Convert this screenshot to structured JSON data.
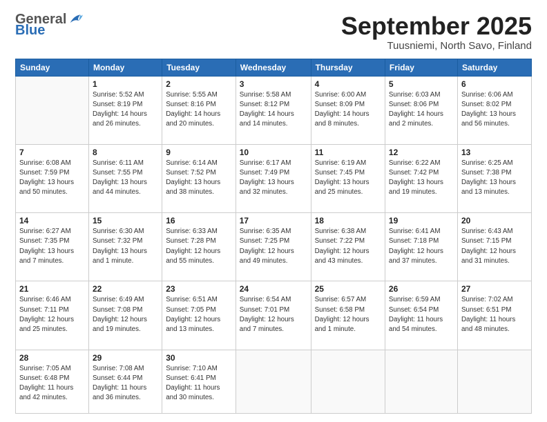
{
  "logo": {
    "general": "General",
    "blue": "Blue"
  },
  "title": "September 2025",
  "subtitle": "Tuusniemi, North Savo, Finland",
  "headers": [
    "Sunday",
    "Monday",
    "Tuesday",
    "Wednesday",
    "Thursday",
    "Friday",
    "Saturday"
  ],
  "weeks": [
    [
      {
        "day": "",
        "info": ""
      },
      {
        "day": "1",
        "info": "Sunrise: 5:52 AM\nSunset: 8:19 PM\nDaylight: 14 hours\nand 26 minutes."
      },
      {
        "day": "2",
        "info": "Sunrise: 5:55 AM\nSunset: 8:16 PM\nDaylight: 14 hours\nand 20 minutes."
      },
      {
        "day": "3",
        "info": "Sunrise: 5:58 AM\nSunset: 8:12 PM\nDaylight: 14 hours\nand 14 minutes."
      },
      {
        "day": "4",
        "info": "Sunrise: 6:00 AM\nSunset: 8:09 PM\nDaylight: 14 hours\nand 8 minutes."
      },
      {
        "day": "5",
        "info": "Sunrise: 6:03 AM\nSunset: 8:06 PM\nDaylight: 14 hours\nand 2 minutes."
      },
      {
        "day": "6",
        "info": "Sunrise: 6:06 AM\nSunset: 8:02 PM\nDaylight: 13 hours\nand 56 minutes."
      }
    ],
    [
      {
        "day": "7",
        "info": "Sunrise: 6:08 AM\nSunset: 7:59 PM\nDaylight: 13 hours\nand 50 minutes."
      },
      {
        "day": "8",
        "info": "Sunrise: 6:11 AM\nSunset: 7:55 PM\nDaylight: 13 hours\nand 44 minutes."
      },
      {
        "day": "9",
        "info": "Sunrise: 6:14 AM\nSunset: 7:52 PM\nDaylight: 13 hours\nand 38 minutes."
      },
      {
        "day": "10",
        "info": "Sunrise: 6:17 AM\nSunset: 7:49 PM\nDaylight: 13 hours\nand 32 minutes."
      },
      {
        "day": "11",
        "info": "Sunrise: 6:19 AM\nSunset: 7:45 PM\nDaylight: 13 hours\nand 25 minutes."
      },
      {
        "day": "12",
        "info": "Sunrise: 6:22 AM\nSunset: 7:42 PM\nDaylight: 13 hours\nand 19 minutes."
      },
      {
        "day": "13",
        "info": "Sunrise: 6:25 AM\nSunset: 7:38 PM\nDaylight: 13 hours\nand 13 minutes."
      }
    ],
    [
      {
        "day": "14",
        "info": "Sunrise: 6:27 AM\nSunset: 7:35 PM\nDaylight: 13 hours\nand 7 minutes."
      },
      {
        "day": "15",
        "info": "Sunrise: 6:30 AM\nSunset: 7:32 PM\nDaylight: 13 hours\nand 1 minute."
      },
      {
        "day": "16",
        "info": "Sunrise: 6:33 AM\nSunset: 7:28 PM\nDaylight: 12 hours\nand 55 minutes."
      },
      {
        "day": "17",
        "info": "Sunrise: 6:35 AM\nSunset: 7:25 PM\nDaylight: 12 hours\nand 49 minutes."
      },
      {
        "day": "18",
        "info": "Sunrise: 6:38 AM\nSunset: 7:22 PM\nDaylight: 12 hours\nand 43 minutes."
      },
      {
        "day": "19",
        "info": "Sunrise: 6:41 AM\nSunset: 7:18 PM\nDaylight: 12 hours\nand 37 minutes."
      },
      {
        "day": "20",
        "info": "Sunrise: 6:43 AM\nSunset: 7:15 PM\nDaylight: 12 hours\nand 31 minutes."
      }
    ],
    [
      {
        "day": "21",
        "info": "Sunrise: 6:46 AM\nSunset: 7:11 PM\nDaylight: 12 hours\nand 25 minutes."
      },
      {
        "day": "22",
        "info": "Sunrise: 6:49 AM\nSunset: 7:08 PM\nDaylight: 12 hours\nand 19 minutes."
      },
      {
        "day": "23",
        "info": "Sunrise: 6:51 AM\nSunset: 7:05 PM\nDaylight: 12 hours\nand 13 minutes."
      },
      {
        "day": "24",
        "info": "Sunrise: 6:54 AM\nSunset: 7:01 PM\nDaylight: 12 hours\nand 7 minutes."
      },
      {
        "day": "25",
        "info": "Sunrise: 6:57 AM\nSunset: 6:58 PM\nDaylight: 12 hours\nand 1 minute."
      },
      {
        "day": "26",
        "info": "Sunrise: 6:59 AM\nSunset: 6:54 PM\nDaylight: 11 hours\nand 54 minutes."
      },
      {
        "day": "27",
        "info": "Sunrise: 7:02 AM\nSunset: 6:51 PM\nDaylight: 11 hours\nand 48 minutes."
      }
    ],
    [
      {
        "day": "28",
        "info": "Sunrise: 7:05 AM\nSunset: 6:48 PM\nDaylight: 11 hours\nand 42 minutes."
      },
      {
        "day": "29",
        "info": "Sunrise: 7:08 AM\nSunset: 6:44 PM\nDaylight: 11 hours\nand 36 minutes."
      },
      {
        "day": "30",
        "info": "Sunrise: 7:10 AM\nSunset: 6:41 PM\nDaylight: 11 hours\nand 30 minutes."
      },
      {
        "day": "",
        "info": ""
      },
      {
        "day": "",
        "info": ""
      },
      {
        "day": "",
        "info": ""
      },
      {
        "day": "",
        "info": ""
      }
    ]
  ]
}
